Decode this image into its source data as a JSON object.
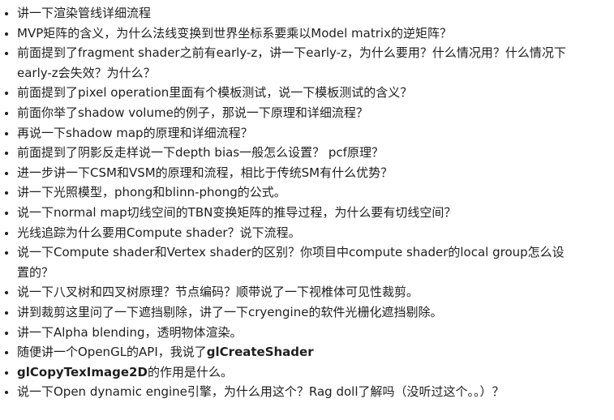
{
  "questions": [
    {
      "parts": [
        {
          "text": "讲一下渲染管线详细流程"
        }
      ]
    },
    {
      "parts": [
        {
          "text": "MVP矩阵的含义，为什么法线变换到世界坐标系要乘以Model matrix的逆矩阵？"
        }
      ]
    },
    {
      "parts": [
        {
          "text": "前面提到了fragment shader之前有early-z，讲一下early-z，为什么要用？什么情况用？什么情况下early-z会失效？为什么？"
        }
      ]
    },
    {
      "parts": [
        {
          "text": "前面提到了pixel operation里面有个模板测试，说一下模板测试的含义？"
        }
      ]
    },
    {
      "parts": [
        {
          "text": "前面你举了shadow volume的例子，那说一下原理和详细流程？"
        }
      ]
    },
    {
      "parts": [
        {
          "text": "再说一下shadow map的原理和详细流程？"
        }
      ]
    },
    {
      "parts": [
        {
          "text": "前面提到了阴影反走样说一下depth bias一般怎么设置？ pcf原理？"
        }
      ]
    },
    {
      "parts": [
        {
          "text": "进一步讲一下CSM和VSM的原理和流程，相比于传统SM有什么优势？"
        }
      ]
    },
    {
      "parts": [
        {
          "text": "讲一下光照模型，phong和blinn-phong的公式。"
        }
      ]
    },
    {
      "parts": [
        {
          "text": "说一下normal map切线空间的TBN变换矩阵的推导过程，为什么要有切线空间？"
        }
      ]
    },
    {
      "parts": [
        {
          "text": "光线追踪为什么要用Compute shader？说下流程。"
        }
      ]
    },
    {
      "parts": [
        {
          "text": "说一下Compute shader和Vertex shader的区别？你项目中compute shader的local group怎么设置的？"
        }
      ]
    },
    {
      "parts": [
        {
          "text": "说一下八叉树和四叉树原理？节点编码？顺带说了一下视椎体可见性裁剪。"
        }
      ]
    },
    {
      "parts": [
        {
          "text": "讲到裁剪这里问了一下遮挡剔除，讲了一下cryengine的软件光栅化遮挡剔除。"
        }
      ]
    },
    {
      "parts": [
        {
          "text": "讲一下Alpha blending，透明物体渲染。"
        }
      ]
    },
    {
      "parts": [
        {
          "text": "随便讲一个OpenGL的API，我说了"
        },
        {
          "text": "glCreateShader",
          "bold": true
        }
      ]
    },
    {
      "parts": [
        {
          "text": "glCopyTexImage2D",
          "bold": true
        },
        {
          "text": "的作用是什么。"
        }
      ]
    },
    {
      "parts": [
        {
          "text": "说一下Open dynamic engine引擎，为什么用这个？Rag doll了解吗（没听过这个。。）？"
        }
      ]
    }
  ]
}
